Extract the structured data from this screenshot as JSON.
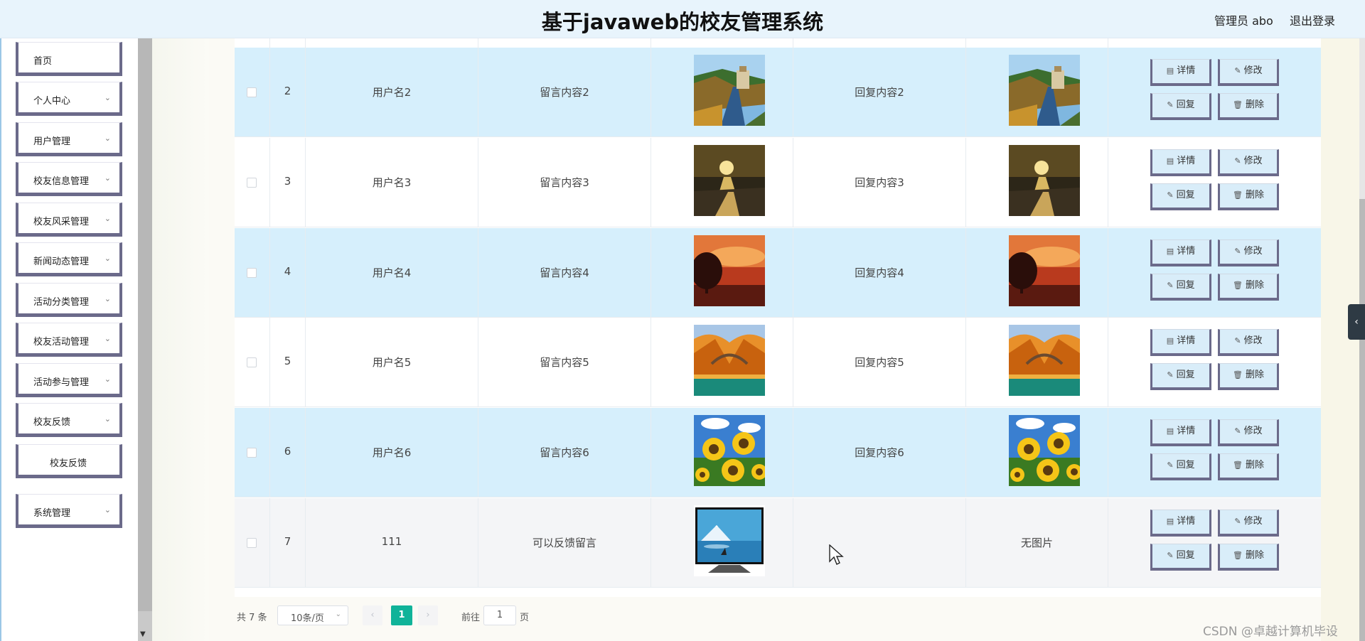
{
  "header": {
    "title": "基于javaweb的校友管理系统",
    "user": "管理员 abo",
    "logout": "退出登录"
  },
  "sidebar": {
    "items": [
      {
        "label": "首页",
        "has_children": false
      },
      {
        "label": "个人中心",
        "has_children": true
      },
      {
        "label": "用户管理",
        "has_children": true
      },
      {
        "label": "校友信息管理",
        "has_children": true
      },
      {
        "label": "校友风采管理",
        "has_children": true
      },
      {
        "label": "新闻动态管理",
        "has_children": true
      },
      {
        "label": "活动分类管理",
        "has_children": true
      },
      {
        "label": "校友活动管理",
        "has_children": true
      },
      {
        "label": "活动参与管理",
        "has_children": true
      },
      {
        "label": "校友反馈",
        "has_children": true,
        "expanded": true
      },
      {
        "label": "校友反馈",
        "sub": true
      },
      {
        "label": "系统管理",
        "has_children": true
      }
    ]
  },
  "table": {
    "rows": [
      {
        "index": "2",
        "username": "用户名2",
        "message": "留言内容2",
        "image": "road-lake",
        "reply": "回复内容2",
        "reply_image": "road-lake",
        "style": "stripe"
      },
      {
        "index": "3",
        "username": "用户名3",
        "message": "留言内容3",
        "image": "sunset-beach",
        "reply": "回复内容3",
        "reply_image": "sunset-beach",
        "style": "plain"
      },
      {
        "index": "4",
        "username": "用户名4",
        "message": "留言内容4",
        "image": "red-sky-tree",
        "reply": "回复内容4",
        "reply_image": "red-sky-tree",
        "style": "stripe"
      },
      {
        "index": "5",
        "username": "用户名5",
        "message": "留言内容5",
        "image": "autumn-bridge",
        "reply": "回复内容5",
        "reply_image": "autumn-bridge",
        "style": "plain"
      },
      {
        "index": "6",
        "username": "用户名6",
        "message": "留言内容6",
        "image": "sunflowers",
        "reply": "回复内容6",
        "reply_image": "sunflowers",
        "style": "stripe"
      },
      {
        "index": "7",
        "username": "111",
        "message": "可以反馈留言",
        "image": "tv-mountain",
        "reply": "",
        "reply_image_text": "无图片",
        "style": "hover"
      }
    ],
    "actions": {
      "detail": "详情",
      "edit": "修改",
      "reply": "回复",
      "delete": "删除"
    }
  },
  "pagination": {
    "total": "共 7 条",
    "page_size": "10条/页",
    "current_page": "1",
    "goto_label": "前往",
    "goto_value": "1",
    "page_suffix": "页"
  },
  "watermark": "CSDN @卓越计算机毕设",
  "colors": {
    "header_bg": "#e8f4fc",
    "stripe_row": "#d6effc",
    "accent": "#10b399",
    "button_border": "#6b6a8a"
  }
}
